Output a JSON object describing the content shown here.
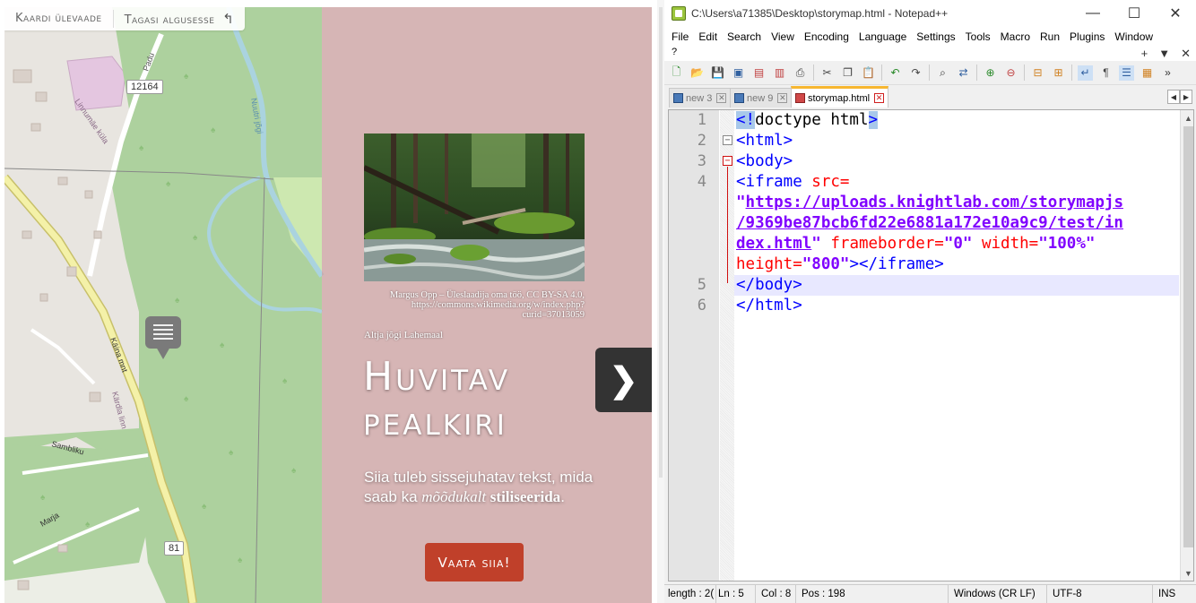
{
  "storymap": {
    "toolbar": {
      "overview_label": "Kaardi ülevaade",
      "back_label": "Tagasi algusesse"
    },
    "map": {
      "road_number_1": "12164",
      "road_number_2": "81",
      "street_padu": "Padu",
      "street_linnumae": "Linnumäe küla",
      "river_name": "Nuutri jõgi",
      "street_kaina": "Käina mnt",
      "street_kardla": "Kärdla linn",
      "street_sambliku": "Sambliku",
      "street_marja": "Marja"
    },
    "slide": {
      "image_credit": "Margus Opp – Üleslaadija oma töö, CC BY-SA 4.0, https://commons.wikimedia.org/w/index.php?curid=37013059",
      "image_caption": "Altja jõgi Lahemaal",
      "headline_line1": "Huvitav",
      "headline_line2": "pealkiri",
      "intro_part1": "Siia tuleb sissejuhatav tekst, mida saab ka",
      "intro_em": "mõõdukalt",
      "intro_strong": "stiliseerida",
      "intro_end": ".",
      "cta_label": "Vaata siia!",
      "next_icon": "chevron-right-icon"
    },
    "colors": {
      "slide_bg": "#cda0a2",
      "cta_bg": "#c0402a",
      "forest": "#a8d099"
    }
  },
  "notepad": {
    "window_title": "C:\\Users\\a71385\\Desktop\\storymap.html - Notepad++",
    "menu": [
      "File",
      "Edit",
      "Search",
      "View",
      "Encoding",
      "Language",
      "Settings",
      "Tools",
      "Macro",
      "Run",
      "Plugins",
      "Window"
    ],
    "menu_help": "?",
    "tabs": [
      {
        "label": "new 3",
        "active": false
      },
      {
        "label": "new 9",
        "active": false
      },
      {
        "label": "storymap.html",
        "active": true
      }
    ],
    "line_numbers": [
      "1",
      "2",
      "3",
      "4",
      "5",
      "6"
    ],
    "code": {
      "l1_a": "<!",
      "l1_b": "doctype html",
      "l1_c": ">",
      "l2": "<html>",
      "l3": "<body>",
      "l4_tag": "<iframe",
      "l4_attr": " src=",
      "l4_q": "\"",
      "l4_url1": "https://uploads.knightlab.com/storymapjs",
      "l4_url2": "/9369be87bcb6fd22e6881a172e10a9c9/test/in",
      "l4_url3": "dex.html",
      "l4_q2": "\"",
      "l4_attr2": " frameborder=",
      "l4_v2": "\"0\"",
      "l4_attr3": " width=",
      "l4_v3": "\"100%\"",
      "l4_attr4": "height=",
      "l4_v4": "\"800\"",
      "l4_end": "></iframe>",
      "l5": "</body>",
      "l6": "</html>"
    },
    "status": {
      "length": "length : 2(",
      "ln": "Ln : 5",
      "col": "Col : 8",
      "pos": "Pos : 198",
      "eol": "Windows (CR LF)",
      "encoding": "UTF-8",
      "mode": "INS"
    }
  }
}
